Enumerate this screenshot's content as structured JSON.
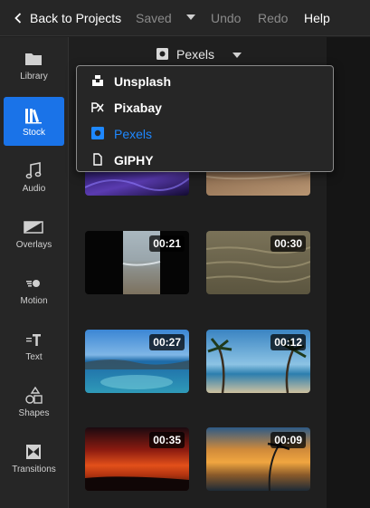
{
  "topbar": {
    "back_label": "Back to Projects",
    "saved_label": "Saved",
    "undo_label": "Undo",
    "redo_label": "Redo",
    "help_label": "Help"
  },
  "sidebar": {
    "items": [
      {
        "label": "Library",
        "icon": "folder-icon",
        "active": false
      },
      {
        "label": "Stock",
        "icon": "stock-books-icon",
        "active": true
      },
      {
        "label": "Audio",
        "icon": "music-note-icon",
        "active": false
      },
      {
        "label": "Overlays",
        "icon": "overlay-icon",
        "active": false
      },
      {
        "label": "Motion",
        "icon": "motion-icon",
        "active": false
      },
      {
        "label": "Text",
        "icon": "text-icon",
        "active": false
      },
      {
        "label": "Shapes",
        "icon": "shapes-icon",
        "active": false
      },
      {
        "label": "Transitions",
        "icon": "transition-icon",
        "active": false
      }
    ]
  },
  "source_selector": {
    "value": "Pexels",
    "icon": "pexels-icon"
  },
  "dropdown": {
    "options": [
      {
        "label": "Unsplash",
        "icon": "unsplash-icon",
        "selected": false
      },
      {
        "label": "Pixabay",
        "icon": "pixabay-icon",
        "selected": false
      },
      {
        "label": "Pexels",
        "icon": "pexels-icon",
        "selected": true
      },
      {
        "label": "GIPHY",
        "icon": "giphy-icon",
        "selected": false
      }
    ]
  },
  "clips": [
    {
      "duration": ""
    },
    {
      "duration": ""
    },
    {
      "duration": "00:21"
    },
    {
      "duration": "00:30"
    },
    {
      "duration": "00:27"
    },
    {
      "duration": "00:12"
    },
    {
      "duration": "00:35"
    },
    {
      "duration": "00:09"
    }
  ],
  "colors": {
    "accent": "#1a73e8",
    "selected_text": "#1e88ff",
    "panel": "#262626",
    "background": "#1f1f1f"
  }
}
